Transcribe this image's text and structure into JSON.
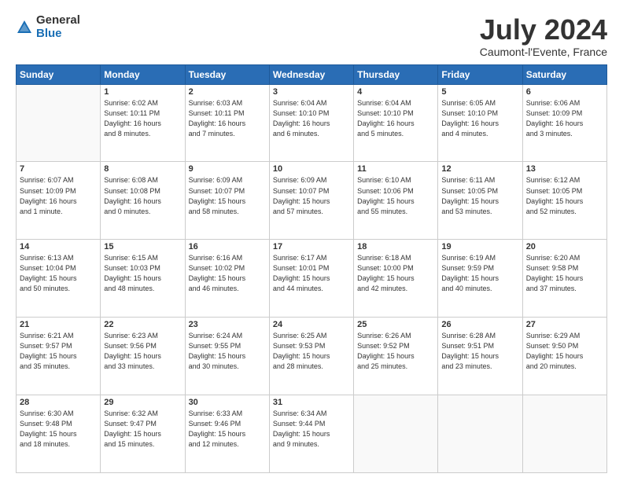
{
  "header": {
    "logo_general": "General",
    "logo_blue": "Blue",
    "title": "July 2024",
    "subtitle": "Caumont-l'Evente, France"
  },
  "calendar": {
    "headers": [
      "Sunday",
      "Monday",
      "Tuesday",
      "Wednesday",
      "Thursday",
      "Friday",
      "Saturday"
    ],
    "rows": [
      [
        {
          "day": "",
          "info": ""
        },
        {
          "day": "1",
          "info": "Sunrise: 6:02 AM\nSunset: 10:11 PM\nDaylight: 16 hours\nand 8 minutes."
        },
        {
          "day": "2",
          "info": "Sunrise: 6:03 AM\nSunset: 10:11 PM\nDaylight: 16 hours\nand 7 minutes."
        },
        {
          "day": "3",
          "info": "Sunrise: 6:04 AM\nSunset: 10:10 PM\nDaylight: 16 hours\nand 6 minutes."
        },
        {
          "day": "4",
          "info": "Sunrise: 6:04 AM\nSunset: 10:10 PM\nDaylight: 16 hours\nand 5 minutes."
        },
        {
          "day": "5",
          "info": "Sunrise: 6:05 AM\nSunset: 10:10 PM\nDaylight: 16 hours\nand 4 minutes."
        },
        {
          "day": "6",
          "info": "Sunrise: 6:06 AM\nSunset: 10:09 PM\nDaylight: 16 hours\nand 3 minutes."
        }
      ],
      [
        {
          "day": "7",
          "info": "Sunrise: 6:07 AM\nSunset: 10:09 PM\nDaylight: 16 hours\nand 1 minute."
        },
        {
          "day": "8",
          "info": "Sunrise: 6:08 AM\nSunset: 10:08 PM\nDaylight: 16 hours\nand 0 minutes."
        },
        {
          "day": "9",
          "info": "Sunrise: 6:09 AM\nSunset: 10:07 PM\nDaylight: 15 hours\nand 58 minutes."
        },
        {
          "day": "10",
          "info": "Sunrise: 6:09 AM\nSunset: 10:07 PM\nDaylight: 15 hours\nand 57 minutes."
        },
        {
          "day": "11",
          "info": "Sunrise: 6:10 AM\nSunset: 10:06 PM\nDaylight: 15 hours\nand 55 minutes."
        },
        {
          "day": "12",
          "info": "Sunrise: 6:11 AM\nSunset: 10:05 PM\nDaylight: 15 hours\nand 53 minutes."
        },
        {
          "day": "13",
          "info": "Sunrise: 6:12 AM\nSunset: 10:05 PM\nDaylight: 15 hours\nand 52 minutes."
        }
      ],
      [
        {
          "day": "14",
          "info": "Sunrise: 6:13 AM\nSunset: 10:04 PM\nDaylight: 15 hours\nand 50 minutes."
        },
        {
          "day": "15",
          "info": "Sunrise: 6:15 AM\nSunset: 10:03 PM\nDaylight: 15 hours\nand 48 minutes."
        },
        {
          "day": "16",
          "info": "Sunrise: 6:16 AM\nSunset: 10:02 PM\nDaylight: 15 hours\nand 46 minutes."
        },
        {
          "day": "17",
          "info": "Sunrise: 6:17 AM\nSunset: 10:01 PM\nDaylight: 15 hours\nand 44 minutes."
        },
        {
          "day": "18",
          "info": "Sunrise: 6:18 AM\nSunset: 10:00 PM\nDaylight: 15 hours\nand 42 minutes."
        },
        {
          "day": "19",
          "info": "Sunrise: 6:19 AM\nSunset: 9:59 PM\nDaylight: 15 hours\nand 40 minutes."
        },
        {
          "day": "20",
          "info": "Sunrise: 6:20 AM\nSunset: 9:58 PM\nDaylight: 15 hours\nand 37 minutes."
        }
      ],
      [
        {
          "day": "21",
          "info": "Sunrise: 6:21 AM\nSunset: 9:57 PM\nDaylight: 15 hours\nand 35 minutes."
        },
        {
          "day": "22",
          "info": "Sunrise: 6:23 AM\nSunset: 9:56 PM\nDaylight: 15 hours\nand 33 minutes."
        },
        {
          "day": "23",
          "info": "Sunrise: 6:24 AM\nSunset: 9:55 PM\nDaylight: 15 hours\nand 30 minutes."
        },
        {
          "day": "24",
          "info": "Sunrise: 6:25 AM\nSunset: 9:53 PM\nDaylight: 15 hours\nand 28 minutes."
        },
        {
          "day": "25",
          "info": "Sunrise: 6:26 AM\nSunset: 9:52 PM\nDaylight: 15 hours\nand 25 minutes."
        },
        {
          "day": "26",
          "info": "Sunrise: 6:28 AM\nSunset: 9:51 PM\nDaylight: 15 hours\nand 23 minutes."
        },
        {
          "day": "27",
          "info": "Sunrise: 6:29 AM\nSunset: 9:50 PM\nDaylight: 15 hours\nand 20 minutes."
        }
      ],
      [
        {
          "day": "28",
          "info": "Sunrise: 6:30 AM\nSunset: 9:48 PM\nDaylight: 15 hours\nand 18 minutes."
        },
        {
          "day": "29",
          "info": "Sunrise: 6:32 AM\nSunset: 9:47 PM\nDaylight: 15 hours\nand 15 minutes."
        },
        {
          "day": "30",
          "info": "Sunrise: 6:33 AM\nSunset: 9:46 PM\nDaylight: 15 hours\nand 12 minutes."
        },
        {
          "day": "31",
          "info": "Sunrise: 6:34 AM\nSunset: 9:44 PM\nDaylight: 15 hours\nand 9 minutes."
        },
        {
          "day": "",
          "info": ""
        },
        {
          "day": "",
          "info": ""
        },
        {
          "day": "",
          "info": ""
        }
      ]
    ]
  }
}
